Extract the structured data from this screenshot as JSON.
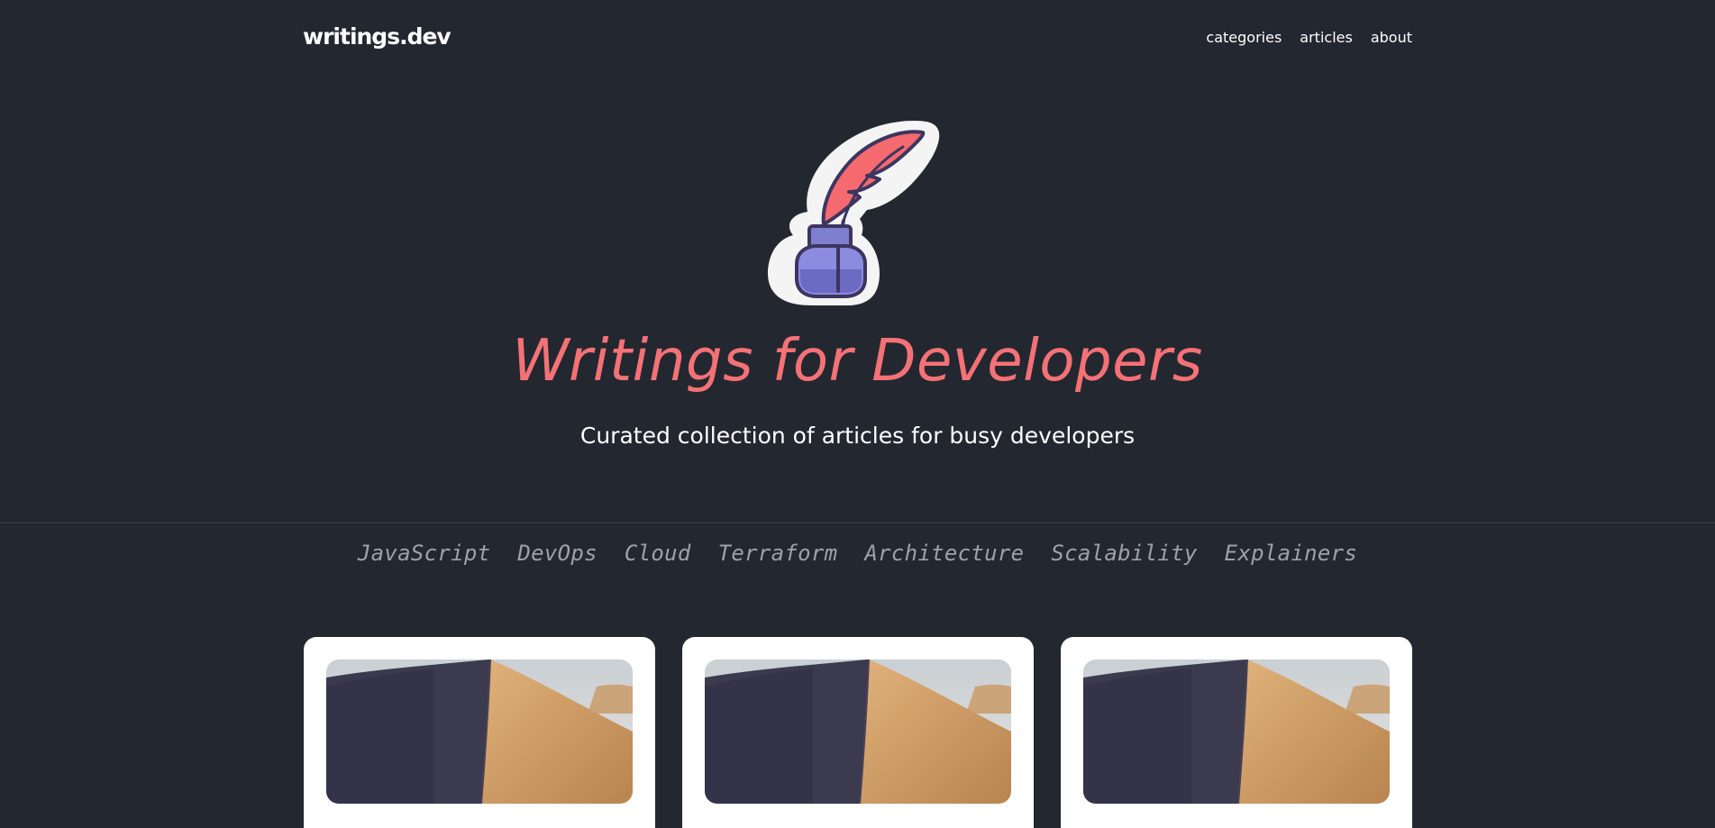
{
  "header": {
    "logo": "writings.dev",
    "nav": [
      "categories",
      "articles",
      "about"
    ]
  },
  "hero": {
    "title": "Writings for Developers",
    "subtitle": "Curated collection of articles for busy developers",
    "illustration_icon": "quill-inkpot-icon"
  },
  "categories": [
    "JavaScript",
    "DevOps",
    "Cloud",
    "Terraform",
    "Architecture",
    "Scalability",
    "Explainers"
  ],
  "cards": [
    {
      "image": "sand-dune-image"
    },
    {
      "image": "sand-dune-image"
    },
    {
      "image": "sand-dune-image"
    }
  ],
  "colors": {
    "background": "#232730",
    "accent": "#f47176",
    "category_text": "#9ea1a7",
    "ink_purple": "#7f7fd0",
    "outline": "#3d3560"
  }
}
